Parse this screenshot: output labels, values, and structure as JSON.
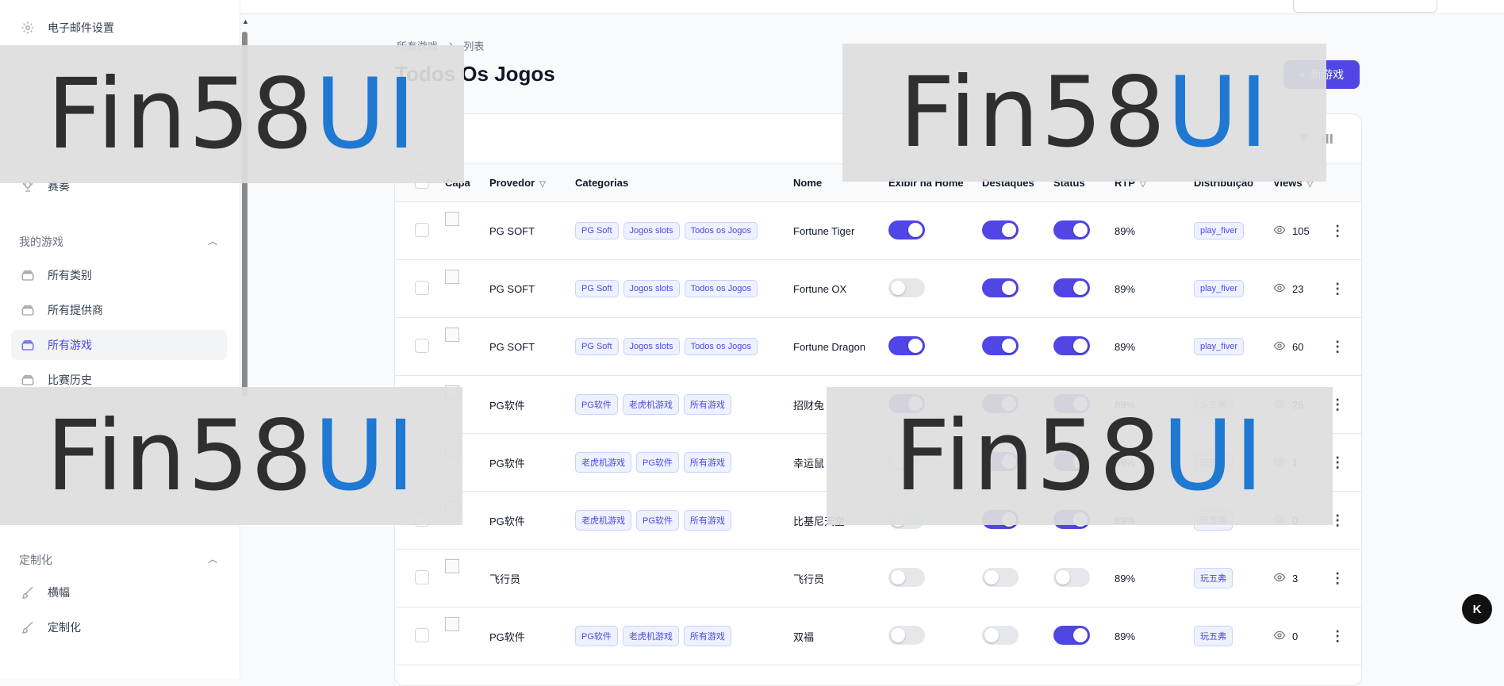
{
  "sidebar": {
    "items_top": [
      {
        "label": "电子邮件设置",
        "icon": "gear-icon"
      },
      {
        "label": "赛奏",
        "icon": "trophy-icon"
      }
    ],
    "groups": [
      {
        "title": "我的游戏",
        "items": [
          {
            "label": "所有类别",
            "icon": "layers-icon"
          },
          {
            "label": "所有提供商",
            "icon": "layers-icon"
          },
          {
            "label": "所有游戏",
            "icon": "layers-icon",
            "active": true
          },
          {
            "label": "比赛历史",
            "icon": "layers-icon"
          }
        ]
      },
      {
        "title": "定制化",
        "items": [
          {
            "label": "横幅",
            "icon": "brush-icon"
          },
          {
            "label": "定制化",
            "icon": "brush-icon"
          }
        ]
      }
    ]
  },
  "breadcrumb": [
    "所有游戏",
    "列表"
  ],
  "page": {
    "title": "Todos Os Jogos",
    "primary_button": "新游戏"
  },
  "table": {
    "headers": [
      "Capa",
      "Provedor",
      "Categorias",
      "Nome",
      "Exibir na Home",
      "Destaques",
      "Status",
      "RTP",
      "Distribuição",
      "Views"
    ],
    "rows": [
      {
        "provider": "PG SOFT",
        "categories": [
          "PG Soft",
          "Jogos slots",
          "Todos os Jogos"
        ],
        "name": "Fortune Tiger",
        "home": true,
        "featured": true,
        "status": true,
        "rtp": "89%",
        "dist": "play_fiver",
        "views": "105"
      },
      {
        "provider": "PG SOFT",
        "categories": [
          "PG Soft",
          "Jogos slots",
          "Todos os Jogos"
        ],
        "name": "Fortune OX",
        "home": false,
        "featured": true,
        "status": true,
        "rtp": "89%",
        "dist": "play_fiver",
        "views": "23"
      },
      {
        "provider": "PG SOFT",
        "categories": [
          "PG Soft",
          "Jogos slots",
          "Todos os Jogos"
        ],
        "name": "Fortune Dragon",
        "home": true,
        "featured": true,
        "status": true,
        "rtp": "89%",
        "dist": "play_fiver",
        "views": "60"
      },
      {
        "provider": "PG软件",
        "categories": [
          "PG软件",
          "老虎机游戏",
          "所有游戏"
        ],
        "name": "招财兔",
        "home": true,
        "featured": true,
        "status": true,
        "rtp": "89%",
        "dist": "玩五弗",
        "views": "26"
      },
      {
        "provider": "PG软件",
        "categories": [
          "老虎机游戏",
          "PG软件",
          "所有游戏"
        ],
        "name": "幸运鼠",
        "home": false,
        "featured": true,
        "status": true,
        "rtp": "89%",
        "dist": "玩五弗",
        "views": "1"
      },
      {
        "provider": "PG软件",
        "categories": [
          "老虎机游戏",
          "PG软件",
          "所有游戏"
        ],
        "name": "比基尼天堂",
        "home": false,
        "featured": true,
        "status": true,
        "rtp": "89%",
        "dist": "玩五弗",
        "views": "0"
      },
      {
        "provider": "飞行员",
        "categories": [],
        "name": "飞行员",
        "home": false,
        "featured": false,
        "status": false,
        "rtp": "89%",
        "dist": "玩五弗",
        "views": "3"
      },
      {
        "provider": "PG软件",
        "categories": [
          "PG软件",
          "老虎机游戏",
          "所有游戏"
        ],
        "name": "双福",
        "home": false,
        "featured": false,
        "status": true,
        "rtp": "89%",
        "dist": "玩五弗",
        "views": "0"
      }
    ]
  },
  "watermark": {
    "dark": "Fin58",
    "blue": "UI"
  },
  "floating_badge": "K"
}
